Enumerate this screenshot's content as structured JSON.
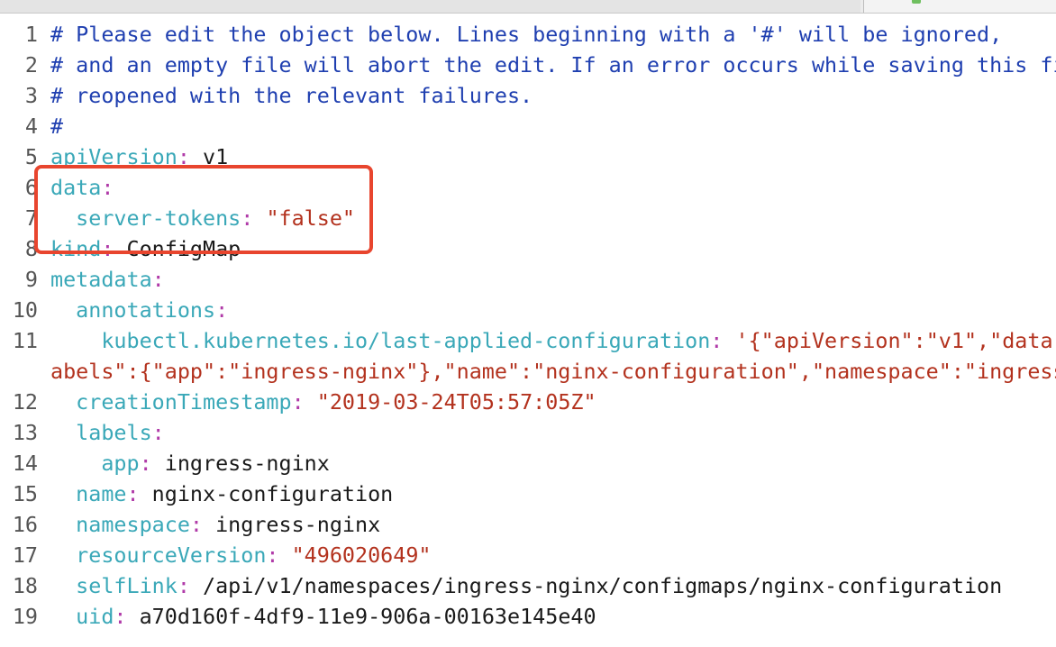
{
  "editor": {
    "lines": [
      {
        "num": "1",
        "parts": [
          {
            "t": "# Please edit the object below. Lines beginning with a '#' will be ignored,",
            "c": "cmt"
          }
        ]
      },
      {
        "num": "2",
        "parts": [
          {
            "t": "# and an empty file will abort the edit. If an error occurs while saving this fi",
            "c": "cmt"
          }
        ]
      },
      {
        "num": "3",
        "parts": [
          {
            "t": "# reopened with the relevant failures.",
            "c": "cmt"
          }
        ]
      },
      {
        "num": "4",
        "parts": [
          {
            "t": "#",
            "c": "cmt"
          }
        ]
      },
      {
        "num": "5",
        "parts": [
          {
            "t": "apiVersion",
            "c": "key"
          },
          {
            "t": ":",
            "c": "colon"
          },
          {
            "t": " v1",
            "c": "plain"
          }
        ]
      },
      {
        "num": "6",
        "parts": [
          {
            "t": "data",
            "c": "key"
          },
          {
            "t": ":",
            "c": "colon"
          }
        ]
      },
      {
        "num": "7",
        "parts": [
          {
            "t": "  server-tokens",
            "c": "key"
          },
          {
            "t": ":",
            "c": "colon"
          },
          {
            "t": " ",
            "c": "plain"
          },
          {
            "t": "\"false\"",
            "c": "str"
          }
        ]
      },
      {
        "num": "8",
        "parts": [
          {
            "t": "kind",
            "c": "key"
          },
          {
            "t": ":",
            "c": "colon"
          },
          {
            "t": " ConfigMap",
            "c": "plain"
          }
        ]
      },
      {
        "num": "9",
        "parts": [
          {
            "t": "metadata",
            "c": "key"
          },
          {
            "t": ":",
            "c": "colon"
          }
        ]
      },
      {
        "num": "10",
        "parts": [
          {
            "t": "  annotations",
            "c": "key"
          },
          {
            "t": ":",
            "c": "colon"
          }
        ]
      },
      {
        "num": "11",
        "parts": [
          {
            "t": "    kubectl.kubernetes.io/last-applied-configuration",
            "c": "key"
          },
          {
            "t": ":",
            "c": "colon"
          },
          {
            "t": " ",
            "c": "plain"
          },
          {
            "t": "'{\"apiVersion\":\"v1\",\"data\"",
            "c": "str"
          }
        ]
      },
      {
        "num": "",
        "parts": [
          {
            "t": "abels\":{\"app\":\"ingress-nginx\"},\"name\":\"nginx-configuration\",\"namespace\":\"ingress",
            "c": "str"
          }
        ]
      },
      {
        "num": "12",
        "parts": [
          {
            "t": "  creationTimestamp",
            "c": "key"
          },
          {
            "t": ":",
            "c": "colon"
          },
          {
            "t": " ",
            "c": "plain"
          },
          {
            "t": "\"2019-03-24T05:57:05Z\"",
            "c": "str"
          }
        ]
      },
      {
        "num": "13",
        "parts": [
          {
            "t": "  labels",
            "c": "key"
          },
          {
            "t": ":",
            "c": "colon"
          }
        ]
      },
      {
        "num": "14",
        "parts": [
          {
            "t": "    app",
            "c": "key"
          },
          {
            "t": ":",
            "c": "colon"
          },
          {
            "t": " ingress-nginx",
            "c": "plain"
          }
        ]
      },
      {
        "num": "15",
        "parts": [
          {
            "t": "  name",
            "c": "key"
          },
          {
            "t": ":",
            "c": "colon"
          },
          {
            "t": " nginx-configuration",
            "c": "plain"
          }
        ]
      },
      {
        "num": "16",
        "parts": [
          {
            "t": "  namespace",
            "c": "key"
          },
          {
            "t": ":",
            "c": "colon"
          },
          {
            "t": " ingress-nginx",
            "c": "plain"
          }
        ]
      },
      {
        "num": "17",
        "parts": [
          {
            "t": "  resourceVersion",
            "c": "key"
          },
          {
            "t": ":",
            "c": "colon"
          },
          {
            "t": " ",
            "c": "plain"
          },
          {
            "t": "\"496020649\"",
            "c": "str"
          }
        ]
      },
      {
        "num": "18",
        "parts": [
          {
            "t": "  selfLink",
            "c": "key"
          },
          {
            "t": ":",
            "c": "colon"
          },
          {
            "t": " /api/v1/namespaces/ingress-nginx/configmaps/nginx-configuration",
            "c": "plain"
          }
        ]
      },
      {
        "num": "19",
        "parts": [
          {
            "t": "  uid",
            "c": "key"
          },
          {
            "t": ":",
            "c": "colon"
          },
          {
            "t": " a70d160f-4df9-11e9-906a-00163e145e40",
            "c": "plain"
          }
        ]
      }
    ]
  },
  "colors": {
    "comment": "#1f3fb0",
    "key": "#3aa8b8",
    "colon": "#b03aa8",
    "string": "#b3321e",
    "highlight_border": "#e8452e"
  },
  "icons": {
    "tab_icon": "file-status-icon"
  }
}
